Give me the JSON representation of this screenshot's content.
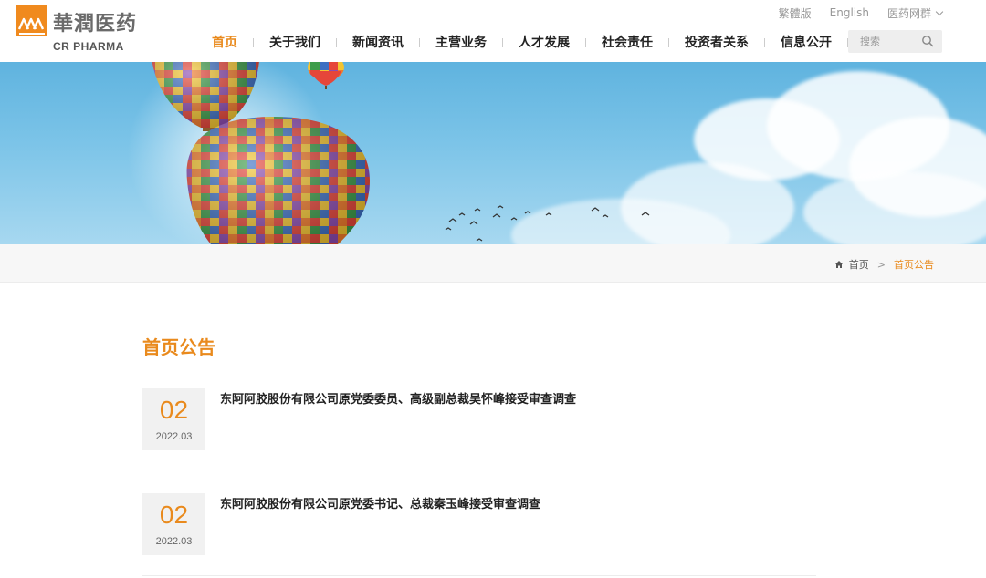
{
  "brand": {
    "name_cn": "華潤医药",
    "name_en": "CR PHARMA",
    "accent_color": "#e98a1d"
  },
  "topbar": {
    "traditional": "繁體版",
    "english": "English",
    "network": "医药网群"
  },
  "nav": {
    "items": [
      {
        "label": "首页",
        "active": true
      },
      {
        "label": "关于我们"
      },
      {
        "label": "新闻资讯"
      },
      {
        "label": "主营业务"
      },
      {
        "label": "人才发展"
      },
      {
        "label": "社会责任"
      },
      {
        "label": "投资者关系"
      },
      {
        "label": "信息公开"
      }
    ]
  },
  "search": {
    "placeholder": "搜索",
    "icon": "search-icon"
  },
  "breadcrumb": {
    "home_icon": "home-icon",
    "home": "首页",
    "separator": ">",
    "current": "首页公告"
  },
  "section": {
    "title": "首页公告"
  },
  "news": [
    {
      "day": "02",
      "year_month": "2022.03",
      "title": "东阿阿胶股份有限公司原党委委员、高级副总裁吴怀峰接受审查调查"
    },
    {
      "day": "02",
      "year_month": "2022.03",
      "title": "东阿阿胶股份有限公司原党委书记、总裁秦玉峰接受审查调查"
    }
  ]
}
